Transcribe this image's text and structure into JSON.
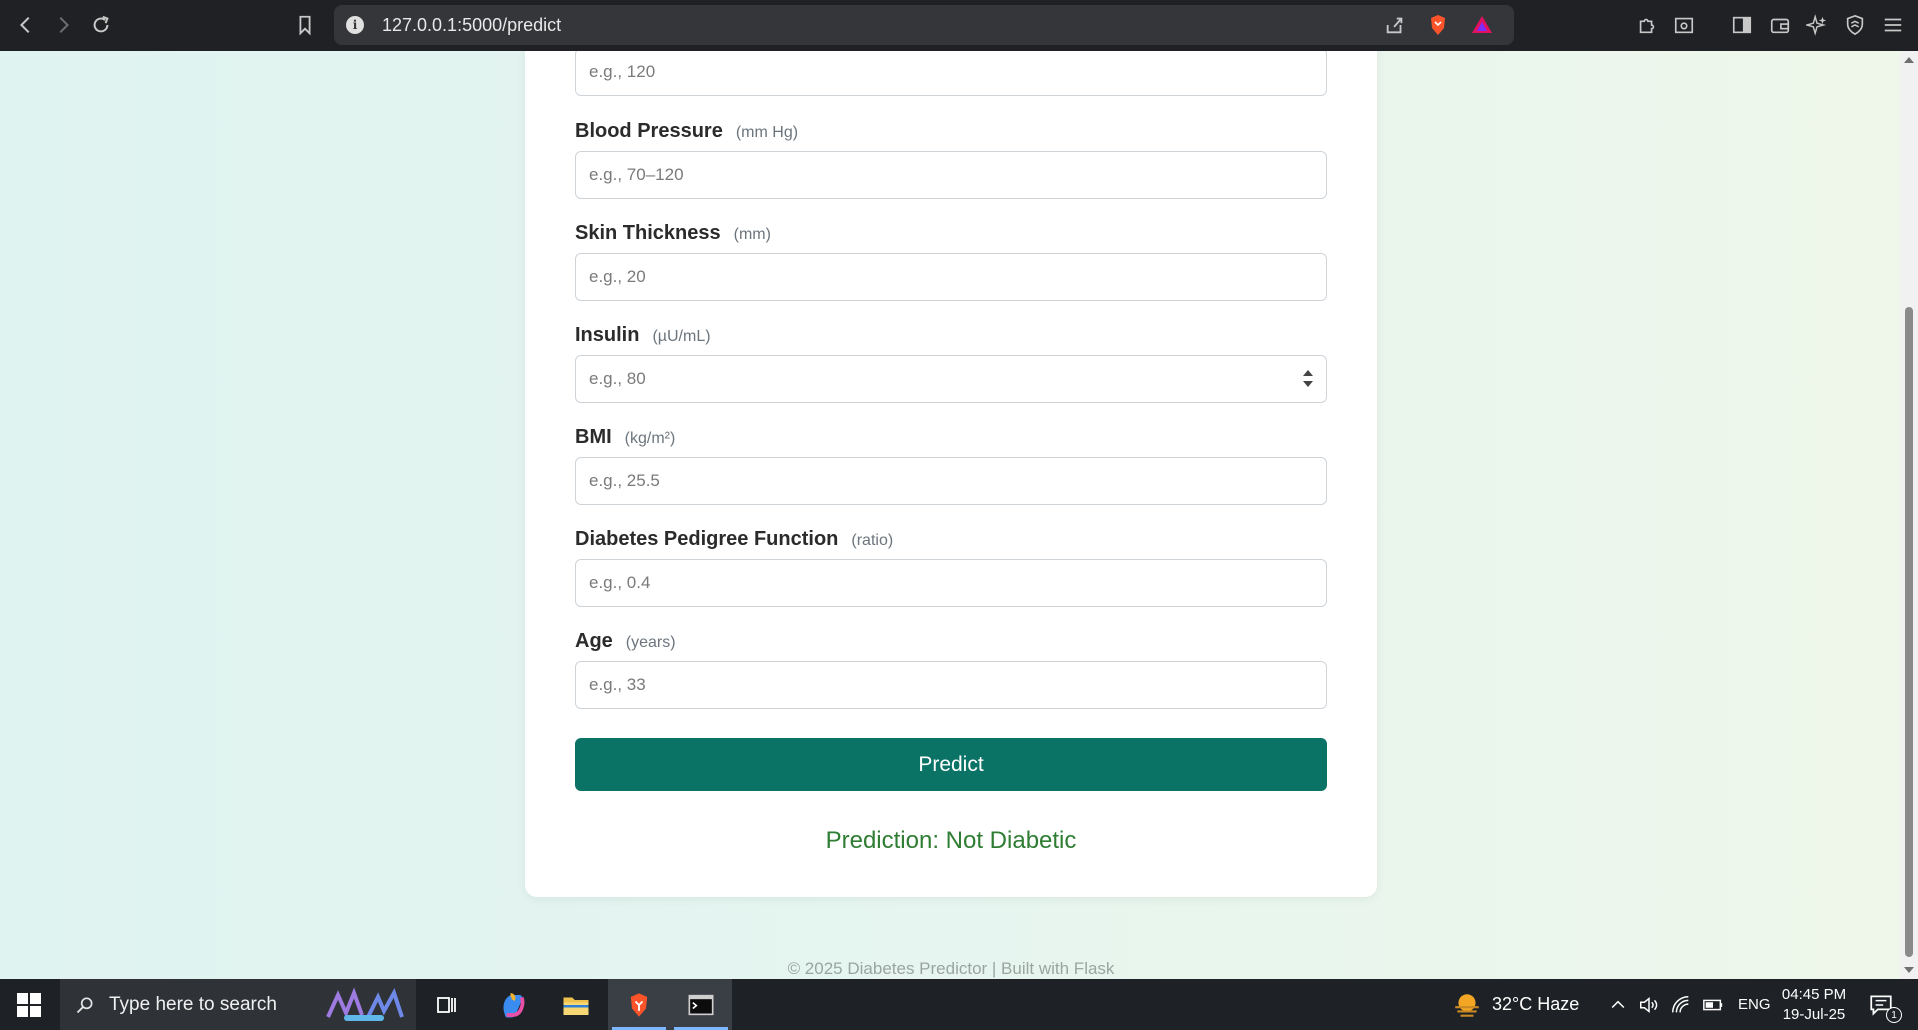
{
  "browser": {
    "url": "127.0.0.1:5000/predict"
  },
  "form": {
    "fields": [
      {
        "label": "",
        "unit": "",
        "placeholder": "e.g., 120"
      },
      {
        "label": "Blood Pressure",
        "unit": "(mm Hg)",
        "placeholder": "e.g., 70–120"
      },
      {
        "label": "Skin Thickness",
        "unit": "(mm)",
        "placeholder": "e.g., 20"
      },
      {
        "label": "Insulin",
        "unit": "(µU/mL)",
        "placeholder": "e.g., 80"
      },
      {
        "label": "BMI",
        "unit": "(kg/m²)",
        "placeholder": "e.g., 25.5"
      },
      {
        "label": "Diabetes Pedigree Function",
        "unit": "(ratio)",
        "placeholder": "e.g., 0.4"
      },
      {
        "label": "Age",
        "unit": "(years)",
        "placeholder": "e.g., 33"
      }
    ],
    "submit_label": "Predict",
    "result": "Prediction: Not Diabetic"
  },
  "footer": {
    "text": "© 2025 Diabetes Predictor | Built with Flask"
  },
  "taskbar": {
    "search_placeholder": "Type here to search",
    "weather": "32°C  Haze",
    "language": "ENG",
    "time": "04:45 PM",
    "date": "19-Jul-25",
    "notification_count": "1"
  },
  "colors": {
    "accent": "#0b7366",
    "result": "#2e7d32"
  }
}
